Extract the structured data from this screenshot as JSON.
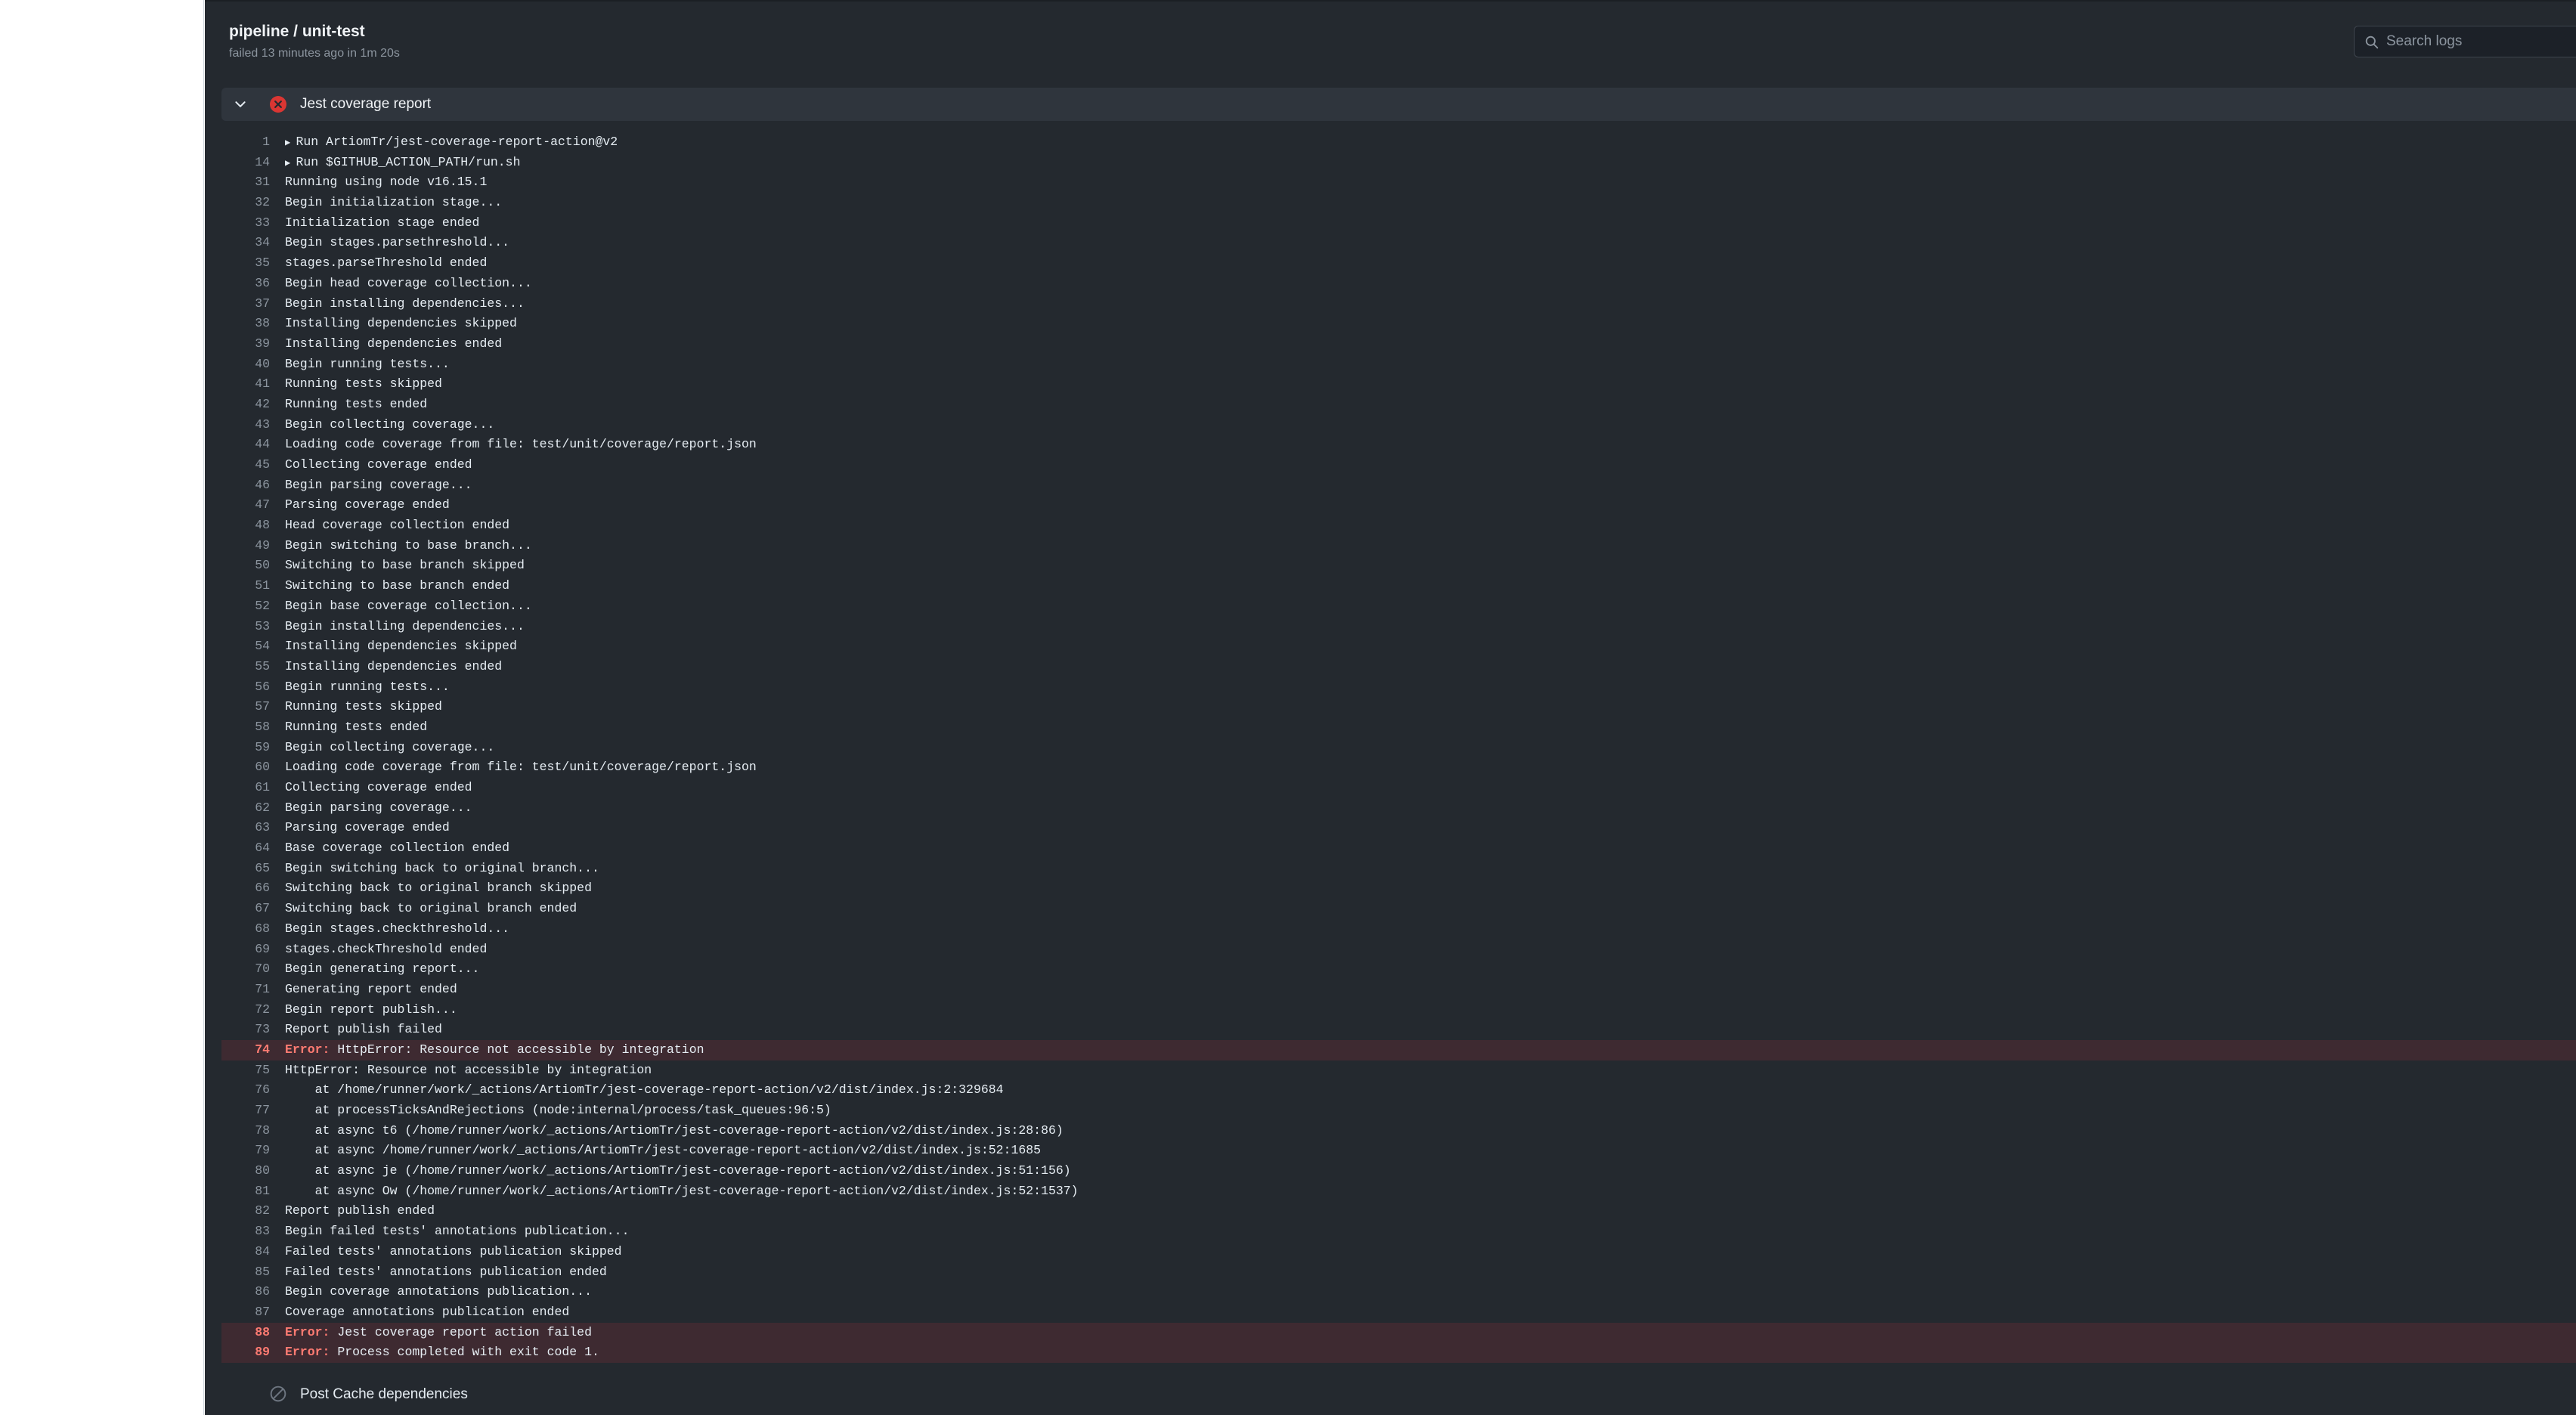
{
  "header": {
    "title": "pipeline / unit-test",
    "status": "failed 13 minutes ago in 1m 20s",
    "search_placeholder": "Search logs"
  },
  "step": {
    "title": "Jest coverage report",
    "lines": [
      {
        "n": "1",
        "t": "Run ArtiomTr/jest-coverage-report-action@v2",
        "collapsed": true
      },
      {
        "n": "14",
        "t": "Run $GITHUB_ACTION_PATH/run.sh",
        "collapsed": true
      },
      {
        "n": "31",
        "t": "Running using node v16.15.1"
      },
      {
        "n": "32",
        "t": "Begin initialization stage..."
      },
      {
        "n": "33",
        "t": "Initialization stage ended"
      },
      {
        "n": "34",
        "t": "Begin stages.parsethreshold..."
      },
      {
        "n": "35",
        "t": "stages.parseThreshold ended"
      },
      {
        "n": "36",
        "t": "Begin head coverage collection..."
      },
      {
        "n": "37",
        "t": "Begin installing dependencies..."
      },
      {
        "n": "38",
        "t": "Installing dependencies skipped"
      },
      {
        "n": "39",
        "t": "Installing dependencies ended"
      },
      {
        "n": "40",
        "t": "Begin running tests..."
      },
      {
        "n": "41",
        "t": "Running tests skipped"
      },
      {
        "n": "42",
        "t": "Running tests ended"
      },
      {
        "n": "43",
        "t": "Begin collecting coverage..."
      },
      {
        "n": "44",
        "t": "Loading code coverage from file: test/unit/coverage/report.json"
      },
      {
        "n": "45",
        "t": "Collecting coverage ended"
      },
      {
        "n": "46",
        "t": "Begin parsing coverage..."
      },
      {
        "n": "47",
        "t": "Parsing coverage ended"
      },
      {
        "n": "48",
        "t": "Head coverage collection ended"
      },
      {
        "n": "49",
        "t": "Begin switching to base branch..."
      },
      {
        "n": "50",
        "t": "Switching to base branch skipped"
      },
      {
        "n": "51",
        "t": "Switching to base branch ended"
      },
      {
        "n": "52",
        "t": "Begin base coverage collection..."
      },
      {
        "n": "53",
        "t": "Begin installing dependencies..."
      },
      {
        "n": "54",
        "t": "Installing dependencies skipped"
      },
      {
        "n": "55",
        "t": "Installing dependencies ended"
      },
      {
        "n": "56",
        "t": "Begin running tests..."
      },
      {
        "n": "57",
        "t": "Running tests skipped"
      },
      {
        "n": "58",
        "t": "Running tests ended"
      },
      {
        "n": "59",
        "t": "Begin collecting coverage..."
      },
      {
        "n": "60",
        "t": "Loading code coverage from file: test/unit/coverage/report.json"
      },
      {
        "n": "61",
        "t": "Collecting coverage ended"
      },
      {
        "n": "62",
        "t": "Begin parsing coverage..."
      },
      {
        "n": "63",
        "t": "Parsing coverage ended"
      },
      {
        "n": "64",
        "t": "Base coverage collection ended"
      },
      {
        "n": "65",
        "t": "Begin switching back to original branch..."
      },
      {
        "n": "66",
        "t": "Switching back to original branch skipped"
      },
      {
        "n": "67",
        "t": "Switching back to original branch ended"
      },
      {
        "n": "68",
        "t": "Begin stages.checkthreshold..."
      },
      {
        "n": "69",
        "t": "stages.checkThreshold ended"
      },
      {
        "n": "70",
        "t": "Begin generating report..."
      },
      {
        "n": "71",
        "t": "Generating report ended"
      },
      {
        "n": "72",
        "t": "Begin report publish..."
      },
      {
        "n": "73",
        "t": "Report publish failed"
      },
      {
        "n": "74",
        "label": "Error:",
        "t": " HttpError: Resource not accessible by integration",
        "error": true
      },
      {
        "n": "75",
        "t": "HttpError: Resource not accessible by integration"
      },
      {
        "n": "76",
        "t": "    at /home/runner/work/_actions/ArtiomTr/jest-coverage-report-action/v2/dist/index.js:2:329684"
      },
      {
        "n": "77",
        "t": "    at processTicksAndRejections (node:internal/process/task_queues:96:5)"
      },
      {
        "n": "78",
        "t": "    at async t6 (/home/runner/work/_actions/ArtiomTr/jest-coverage-report-action/v2/dist/index.js:28:86)"
      },
      {
        "n": "79",
        "t": "    at async /home/runner/work/_actions/ArtiomTr/jest-coverage-report-action/v2/dist/index.js:52:1685"
      },
      {
        "n": "80",
        "t": "    at async je (/home/runner/work/_actions/ArtiomTr/jest-coverage-report-action/v2/dist/index.js:51:156)"
      },
      {
        "n": "81",
        "t": "    at async Ow (/home/runner/work/_actions/ArtiomTr/jest-coverage-report-action/v2/dist/index.js:52:1537)"
      },
      {
        "n": "82",
        "t": "Report publish ended"
      },
      {
        "n": "83",
        "t": "Begin failed tests' annotations publication..."
      },
      {
        "n": "84",
        "t": "Failed tests' annotations publication skipped"
      },
      {
        "n": "85",
        "t": "Failed tests' annotations publication ended"
      },
      {
        "n": "86",
        "t": "Begin coverage annotations publication..."
      },
      {
        "n": "87",
        "t": "Coverage annotations publication ended"
      },
      {
        "n": "88",
        "label": "Error:",
        "t": " Jest coverage report action failed",
        "error": true
      },
      {
        "n": "89",
        "label": "Error:",
        "t": " Process completed with exit code 1.",
        "error": true
      }
    ]
  },
  "post_step": {
    "title": "Post Cache dependencies"
  },
  "colors": {
    "background": "#24292f",
    "error": "#ff7b72",
    "failed_icon": "#da3633",
    "error_row": "#3e2a31"
  }
}
